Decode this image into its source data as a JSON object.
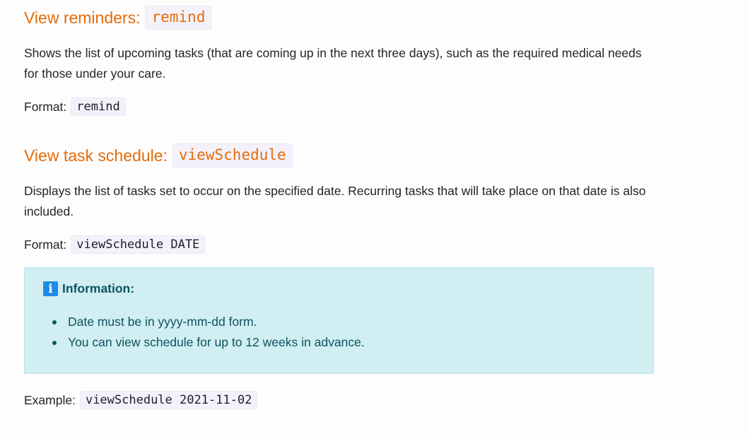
{
  "sections": [
    {
      "heading": "View reminders:",
      "command": "remind",
      "description": "Shows the list of upcoming tasks (that are coming up in the next three days), such as the required medical needs for those under your care.",
      "format_label": "Format:",
      "format_code": "remind"
    },
    {
      "heading": "View task schedule:",
      "command": "viewSchedule",
      "description": "Displays the list of tasks set to occur on the specified date. Recurring tasks that will take place on that date is also included.",
      "format_label": "Format:",
      "format_code": "viewSchedule DATE"
    }
  ],
  "info_box": {
    "icon": "info-icon",
    "icon_glyph": "i",
    "title": "Information:",
    "items": [
      "Date must be in yyyy-mm-dd form.",
      "You can view schedule for up to 12 weeks in advance."
    ]
  },
  "example": {
    "label": "Example:",
    "code": "viewSchedule 2021-11-02"
  },
  "colors": {
    "heading": "#e46c0a",
    "info_bg": "#d1eef2",
    "info_text": "#0c5460",
    "info_icon": "#1e8ce6"
  }
}
